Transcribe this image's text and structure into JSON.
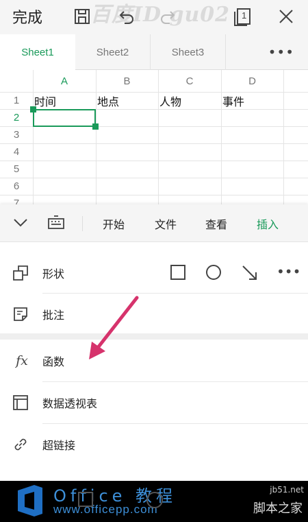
{
  "topbar": {
    "done_label": "完成",
    "watermark": "百度ID gu02",
    "icons": [
      "save-icon",
      "undo-icon",
      "redo-icon",
      "sheets-count-icon",
      "close-icon"
    ],
    "sheets_count": "1"
  },
  "tabs": {
    "items": [
      {
        "label": "Sheet1",
        "active": true
      },
      {
        "label": "Sheet2",
        "active": false
      },
      {
        "label": "Sheet3",
        "active": false
      }
    ],
    "more_label": "•••"
  },
  "grid": {
    "columns": [
      "A",
      "B",
      "C",
      "D"
    ],
    "rows": [
      "1",
      "2",
      "3",
      "4",
      "5",
      "6",
      "7"
    ],
    "row1": [
      "时间",
      "地点",
      "人物",
      "事件"
    ],
    "selected_cell": "A2",
    "accent": "#1a9a5a"
  },
  "panel": {
    "menu": {
      "items": [
        "开始",
        "文件",
        "查看",
        "插入"
      ],
      "active": "插入"
    },
    "rows": [
      {
        "label": "形状",
        "icon": "shape-icon"
      },
      {
        "label": "批注",
        "icon": "comment-icon"
      },
      {
        "label": "函数",
        "icon": "function-icon",
        "icon_text": "fx"
      },
      {
        "label": "数据透视表",
        "icon": "pivot-table-icon"
      },
      {
        "label": "超链接",
        "icon": "link-icon"
      }
    ],
    "shape_more": "•••",
    "arrow_color": "#d6336c"
  },
  "bottombar": {
    "brand": "Office 教程",
    "url": "www.officepp.com",
    "right_top": "jb51.net",
    "right_bottom": "脚本之家"
  }
}
